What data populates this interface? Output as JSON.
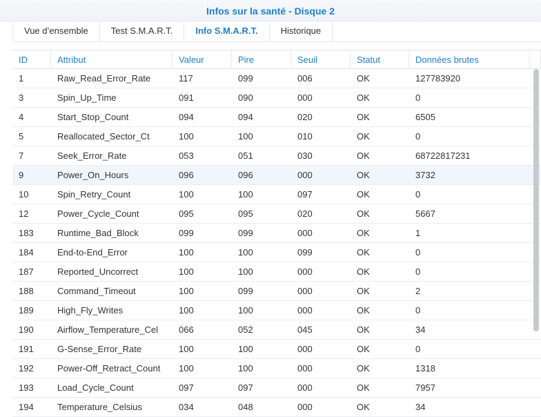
{
  "window": {
    "title": "Infos sur la santé - Disque 2"
  },
  "tabs": [
    {
      "label": "Vue d’ensemble",
      "active": false
    },
    {
      "label": "Test S.M.A.R.T.",
      "active": false
    },
    {
      "label": "Info S.M.A.R.T.",
      "active": true
    },
    {
      "label": "Historique",
      "active": false
    }
  ],
  "table": {
    "columns": [
      "ID",
      "Attribut",
      "Valeur",
      "Pire",
      "Seuil",
      "Statut",
      "Données brutes"
    ],
    "selected_row": 5,
    "rows": [
      [
        "1",
        "Raw_Read_Error_Rate",
        "117",
        "099",
        "006",
        "OK",
        "127783920"
      ],
      [
        "3",
        "Spin_Up_Time",
        "091",
        "090",
        "000",
        "OK",
        "0"
      ],
      [
        "4",
        "Start_Stop_Count",
        "094",
        "094",
        "020",
        "OK",
        "6505"
      ],
      [
        "5",
        "Reallocated_Sector_Ct",
        "100",
        "100",
        "010",
        "OK",
        "0"
      ],
      [
        "7",
        "Seek_Error_Rate",
        "053",
        "051",
        "030",
        "OK",
        "68722817231"
      ],
      [
        "9",
        "Power_On_Hours",
        "096",
        "096",
        "000",
        "OK",
        "3732"
      ],
      [
        "10",
        "Spin_Retry_Count",
        "100",
        "100",
        "097",
        "OK",
        "0"
      ],
      [
        "12",
        "Power_Cycle_Count",
        "095",
        "095",
        "020",
        "OK",
        "5667"
      ],
      [
        "183",
        "Runtime_Bad_Block",
        "099",
        "099",
        "000",
        "OK",
        "1"
      ],
      [
        "184",
        "End-to-End_Error",
        "100",
        "100",
        "099",
        "OK",
        "0"
      ],
      [
        "187",
        "Reported_Uncorrect",
        "100",
        "100",
        "000",
        "OK",
        "0"
      ],
      [
        "188",
        "Command_Timeout",
        "100",
        "099",
        "000",
        "OK",
        "2"
      ],
      [
        "189",
        "High_Fly_Writes",
        "100",
        "100",
        "000",
        "OK",
        "0"
      ],
      [
        "190",
        "Airflow_Temperature_Cel",
        "066",
        "052",
        "045",
        "OK",
        "34"
      ],
      [
        "191",
        "G-Sense_Error_Rate",
        "100",
        "100",
        "000",
        "OK",
        "0"
      ],
      [
        "192",
        "Power-Off_Retract_Count",
        "100",
        "100",
        "000",
        "OK",
        "1318"
      ],
      [
        "193",
        "Load_Cycle_Count",
        "097",
        "097",
        "000",
        "OK",
        "7957"
      ],
      [
        "194",
        "Temperature_Celsius",
        "034",
        "048",
        "000",
        "OK",
        "34"
      ]
    ]
  },
  "colors": {
    "accent": "#1f7fcc",
    "selected_row_bg": "#f1f6fc"
  }
}
